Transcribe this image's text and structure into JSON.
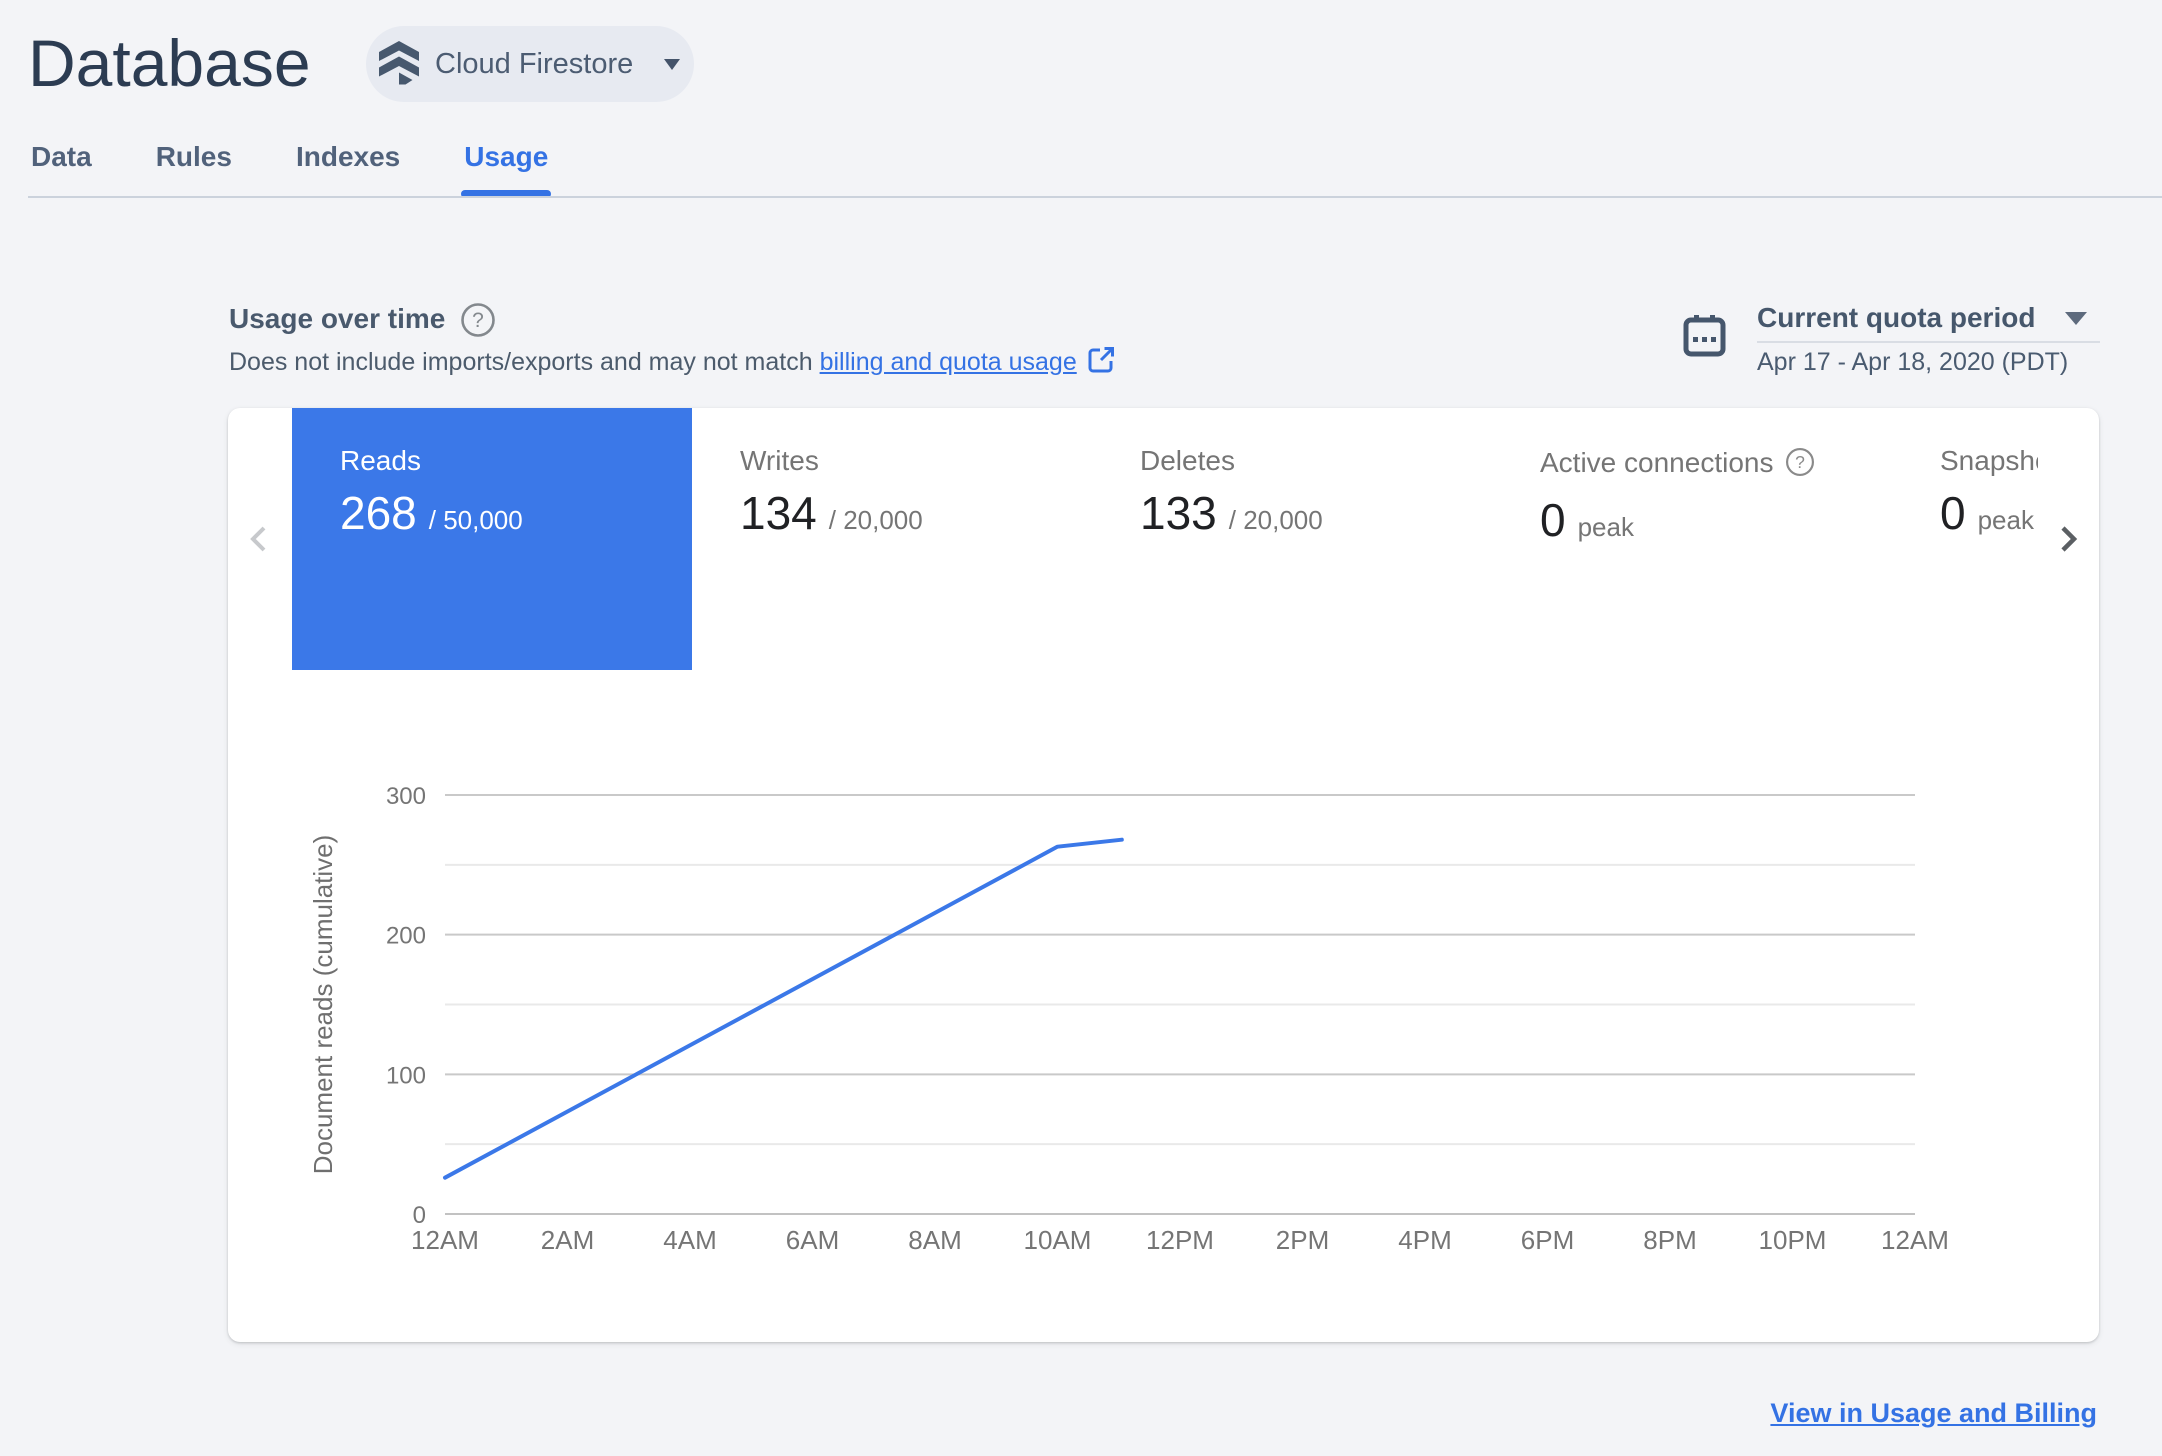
{
  "header": {
    "title": "Database",
    "product_selector": {
      "label": "Cloud Firestore",
      "icon": "firestore-icon"
    },
    "tabs": [
      {
        "label": "Data",
        "active": false
      },
      {
        "label": "Rules",
        "active": false
      },
      {
        "label": "Indexes",
        "active": false
      },
      {
        "label": "Usage",
        "active": true
      }
    ]
  },
  "usage_section": {
    "title": "Usage over time",
    "help_icon": "help-icon",
    "subtitle_prefix": "Does not include imports/exports and may not match ",
    "subtitle_link": "billing and quota usage",
    "external_icon": "external-link-icon"
  },
  "period": {
    "calendar_icon": "calendar-icon",
    "label": "Current quota period",
    "range": "Apr 17 - Apr 18, 2020 (PDT)"
  },
  "metrics": [
    {
      "id": "reads",
      "label": "Reads",
      "value": "268",
      "quota": "/ 50,000",
      "selected": true
    },
    {
      "id": "writes",
      "label": "Writes",
      "value": "134",
      "quota": "/ 20,000",
      "selected": false
    },
    {
      "id": "deletes",
      "label": "Deletes",
      "value": "133",
      "quota": "/ 20,000",
      "selected": false
    },
    {
      "id": "active-connections",
      "label": "Active connections",
      "value": "0",
      "quota": "peak",
      "selected": false,
      "help_icon": "help-icon"
    },
    {
      "id": "snapshot-listeners",
      "label": "Snapshot listeners",
      "value": "0",
      "quota": "peak",
      "selected": false
    }
  ],
  "chart_data": {
    "type": "line",
    "title": "",
    "xlabel": "",
    "ylabel": "Document reads (cumulative)",
    "ylim": [
      0,
      300
    ],
    "y_labeled_ticks": [
      0,
      100,
      200,
      300
    ],
    "y_gridline_step": 50,
    "x_ticks": [
      "12AM",
      "2AM",
      "4AM",
      "6AM",
      "8AM",
      "10AM",
      "12PM",
      "2PM",
      "4PM",
      "6PM",
      "8PM",
      "10PM",
      "12AM"
    ],
    "x_tick_hours": [
      0,
      2,
      4,
      6,
      8,
      10,
      12,
      14,
      16,
      18,
      20,
      22,
      24
    ],
    "x_range_hours": [
      0,
      24
    ],
    "grid": "horizontal-only",
    "legend": "none",
    "series": [
      {
        "name": "Document reads (cumulative)",
        "color": "#3b78e8",
        "points": [
          {
            "hour": 0,
            "value": 26
          },
          {
            "hour": 10,
            "value": 263
          },
          {
            "hour": 11.05,
            "value": 268
          }
        ]
      }
    ]
  },
  "footer": {
    "link_label": "View in Usage and Billing"
  },
  "colors": {
    "page_background": "#f3f4f7",
    "card_background": "#ffffff",
    "title_navy": "#2c3c52",
    "slate_text": "#49596d",
    "tab_inactive": "#51627b",
    "accent_blue": "#3472e4",
    "selected_metric_blue": "#3b78e8",
    "gray_label": "#757575",
    "value_black": "#202124",
    "grid_major": "#c9c9c9",
    "grid_minor": "#e9e9e9",
    "grid_baseline": "#c2c2c2"
  }
}
